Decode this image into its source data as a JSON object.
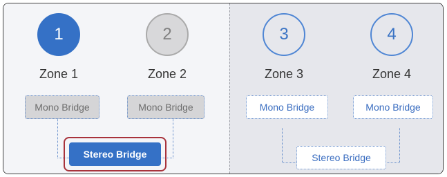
{
  "zones": [
    {
      "number": "1",
      "label": "Zone 1",
      "state": "selected"
    },
    {
      "number": "2",
      "label": "Zone 2",
      "state": "disabled"
    },
    {
      "number": "3",
      "label": "Zone 3",
      "state": "available"
    },
    {
      "number": "4",
      "label": "Zone 4",
      "state": "available"
    }
  ],
  "left_group": {
    "mono_bridges": [
      "Mono Bridge",
      "Mono Bridge"
    ],
    "stereo_bridge": "Stereo Bridge"
  },
  "right_group": {
    "mono_bridges": [
      "Mono Bridge",
      "Mono Bridge"
    ],
    "stereo_bridge": "Stereo Bridge"
  },
  "colors": {
    "accent": "#3571c6",
    "highlight": "#a8323b",
    "disabled": "#d5d5d7"
  }
}
